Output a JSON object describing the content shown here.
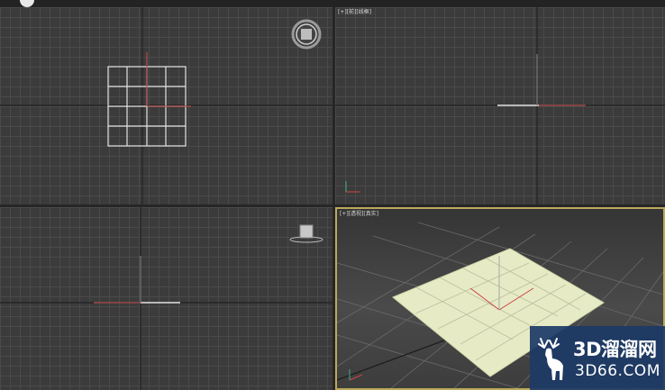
{
  "viewports": {
    "top_label": "",
    "front_label": "[+][前][线框]",
    "left_label": "",
    "perspective_label": "[+][透视][真实]"
  },
  "watermark": {
    "brand": "3D溜溜网",
    "site": "3D66.COM",
    "icon": "deer-icon"
  },
  "colors": {
    "viewport_bg": "#3b3b3b",
    "grid_line": "#4a4a4a",
    "active_border": "#bba95a",
    "plane_fill": "#e6ebc6",
    "watermark_bg": "#1c3a66"
  }
}
